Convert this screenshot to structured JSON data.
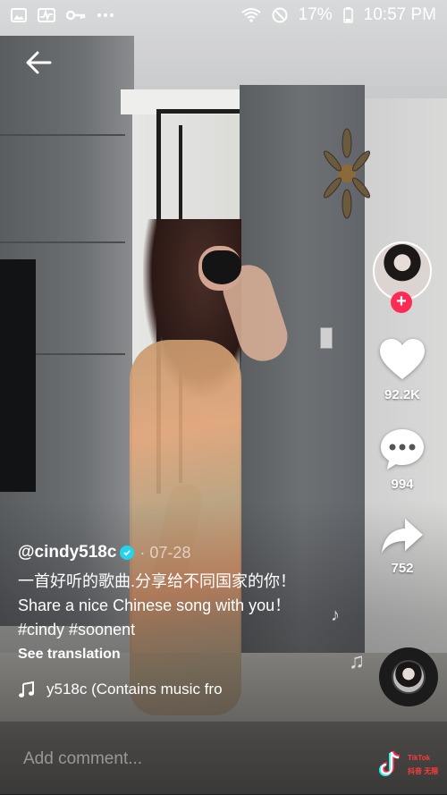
{
  "status_bar": {
    "battery_percent": "17%",
    "time": "10:57 PM"
  },
  "rail": {
    "likes": "92.2K",
    "comments": "994",
    "shares": "752"
  },
  "caption": {
    "username": "@cindy518c",
    "date": "· 07-28",
    "description": "一首好听的歌曲.分享给不同国家的你！Share a nice Chinese song with you！#cindy #soonent",
    "see_translation": "See translation"
  },
  "music": {
    "text": "y518c (Contains music fro"
  },
  "comment_bar": {
    "placeholder": "Add comment..."
  },
  "watermark": {
    "line1": "TikTok",
    "line2": "抖音 无限"
  },
  "colors": {
    "follow": "#fe2c55",
    "verified": "#20d5ec"
  }
}
